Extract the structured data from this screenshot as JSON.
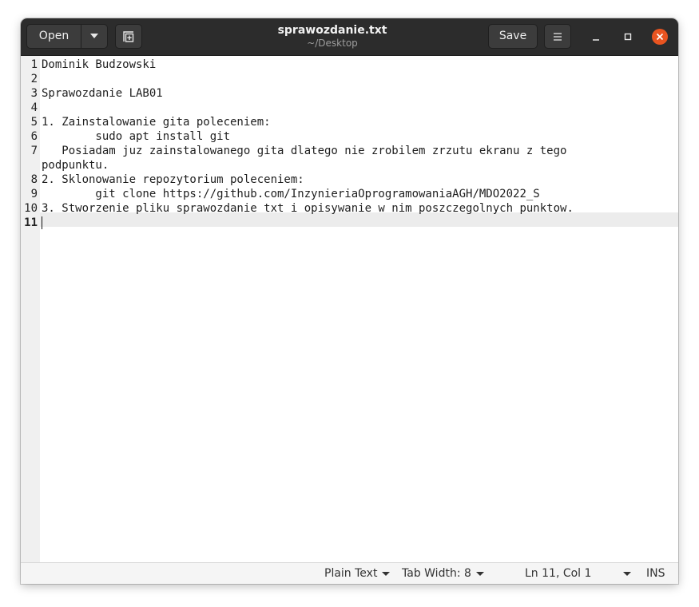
{
  "window": {
    "title": "sprawozdanie.txt",
    "subtitle": "~/Desktop"
  },
  "toolbar": {
    "open_label": "Open",
    "save_label": "Save"
  },
  "editor": {
    "line_numbers": [
      "1",
      "2",
      "3",
      "4",
      "5",
      "6",
      "7",
      "",
      "8",
      "9",
      "10",
      "11"
    ],
    "lines": [
      "Dominik Budzowski",
      "",
      "Sprawozdanie LAB01",
      "",
      "1. Zainstalowanie gita poleceniem:",
      "        sudo apt install git",
      "   Posiadam juz zainstalowanego gita dlatego nie zrobilem zrzutu ekranu z tego",
      "podpunktu.",
      "2. Sklonowanie repozytorium poleceniem:",
      "        git clone https://github.com/InzynieriaOprogramowaniaAGH/MDO2022_S",
      "3. Stworzenie pliku sprawozdanie txt i opisywanie w nim poszczegolnych punktow.",
      ""
    ],
    "current_line": "11"
  },
  "statusbar": {
    "language": "Plain Text",
    "tab_width": "Tab Width: 8",
    "position": "Ln 11, Col 1",
    "mode": "INS"
  },
  "colors": {
    "headerbar": "#2c2c2c",
    "close_button": "#e95420",
    "gutter": "#f0f0f0",
    "current_line": "#ececec"
  },
  "icons": {
    "open_menu": "chevron-down-icon",
    "new_tab": "new-tab-icon",
    "menu": "hamburger-icon",
    "minimize": "minimize-icon",
    "maximize": "maximize-icon",
    "close": "close-icon"
  }
}
